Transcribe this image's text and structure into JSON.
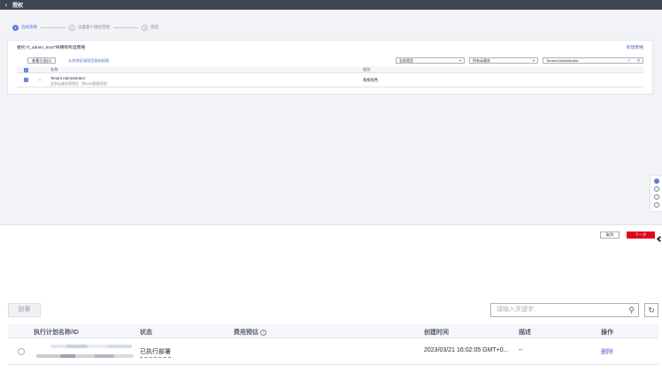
{
  "topbar": {
    "back_icon": "chevron-left-icon",
    "title": "授权"
  },
  "steps": [
    {
      "num": "1",
      "label": "选择策略",
      "active": true
    },
    {
      "num": "2",
      "label": "设置最小授权范围",
      "active": false
    },
    {
      "num": "3",
      "label": "完成",
      "active": false
    }
  ],
  "policy_card": {
    "heading": "委托\"rf_admin_trust\"将拥有所选策略",
    "new_policy": "新建策略",
    "view_selected": "查看已选(1)",
    "hint_link": "从其他区域项目复制权限",
    "filter_type": "全部类型",
    "filter_service": "所有云服务",
    "search_value": "Tenant Administrator",
    "columns": {
      "name": "名称",
      "type": "类别"
    },
    "rows": [
      {
        "name": "Tenant Administrator",
        "description": "全部云服务管理员（除IAM管理权限）",
        "type": "系统角色"
      }
    ]
  },
  "footer": {
    "cancel": "取消",
    "next": "下一步"
  },
  "list": {
    "deploy": "部署",
    "search_placeholder": "请输入关键字",
    "columns": {
      "name": "执行计划名称/ID",
      "status": "状态",
      "cost": "费用预估",
      "created": "创建时间",
      "desc": "描述",
      "op": "操作"
    },
    "rows": [
      {
        "status": "已执行部署",
        "created": "2023/03/21 16:02:05 GMT+0...",
        "desc": "--",
        "op": "删除"
      }
    ]
  },
  "colors": {
    "primary": "#5e7ce0",
    "link": "#526ecc",
    "danger": "#e0061f",
    "topbar": "#3d4552"
  }
}
